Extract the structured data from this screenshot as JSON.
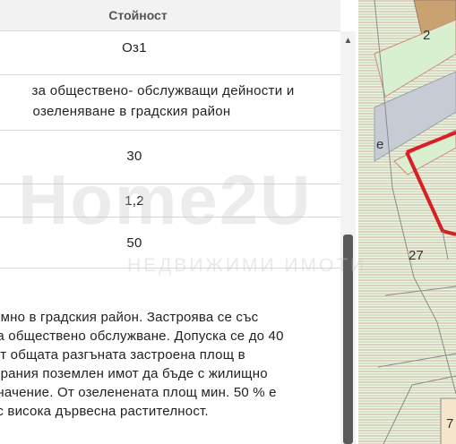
{
  "table": {
    "header": "Стойност",
    "rows": [
      {
        "value": "Оз1"
      },
      {
        "line1": "за обществено- обслужващи дейности и",
        "line2": "озеленяване в градския район"
      },
      {
        "value": "30"
      },
      {
        "value": "1,2"
      },
      {
        "value": "50"
      }
    ],
    "description": "имно в градския район. Застроява се със\n а обществено обслужване. Допуска се до 40\nот общата разгъната застроена площ в\nирания поземлен имот да бъде с жилищно\n начение. От озеленената площ мин. 50 % е\n с висока дървесна растителност."
  },
  "map": {
    "labels": {
      "plot_2": "2",
      "plot_27": "27",
      "plot_7": "7",
      "street": "е"
    }
  },
  "watermark": {
    "main": "Home2U",
    "sub": "НЕДВИЖИМИ ИМОТИ"
  },
  "colors": {
    "accent": "#d91f26",
    "map_hatch": "#cfe3bf",
    "map_line": "#c98b7e"
  }
}
